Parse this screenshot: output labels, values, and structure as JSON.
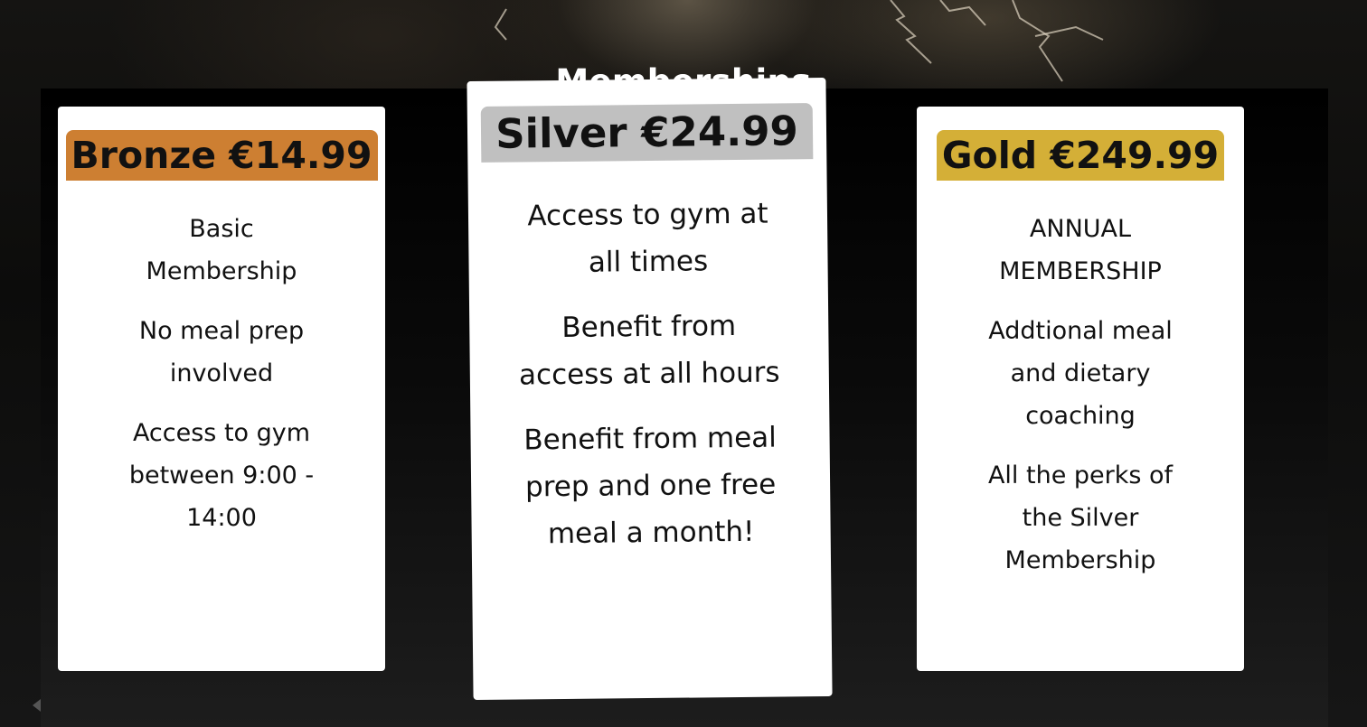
{
  "page": {
    "title": "Memberships"
  },
  "colors": {
    "bronze": "#cd7f32",
    "silver": "#c0c0c0",
    "gold": "#d4af37",
    "card_bg": "#ffffff",
    "panel_bg": "#000000"
  },
  "plans": {
    "bronze": {
      "price_label": "Bronze €14.99",
      "features": [
        "Basic Membership",
        "No meal prep involved",
        "Access to gym between 9:00 - 14:00"
      ]
    },
    "silver": {
      "price_label": "Silver €24.99",
      "features": [
        "Access to gym at all times",
        "Benefit from access at all hours",
        "Benefit from meal prep and one free meal a month!"
      ]
    },
    "gold": {
      "price_label": "Gold €249.99",
      "features": [
        "ANNUAL MEMBERSHIP",
        "Addtional meal and dietary coaching",
        "All the perks of the Silver Membership"
      ]
    }
  }
}
